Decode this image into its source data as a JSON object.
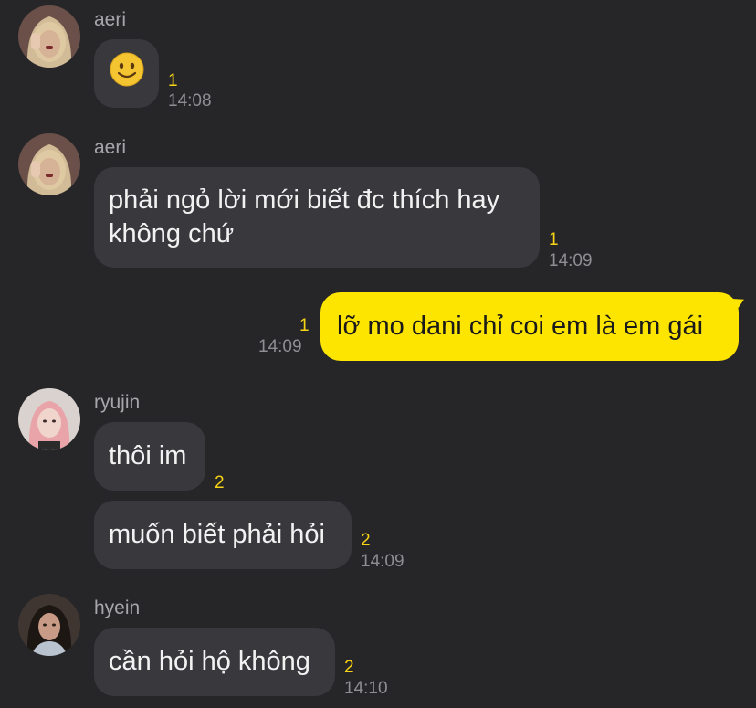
{
  "messages": [
    {
      "sender": "aeri",
      "avatar": "avatar-aeri",
      "text": "🙂",
      "unread": "1",
      "time": "14:08"
    },
    {
      "sender": "aeri",
      "avatar": "avatar-aeri",
      "text": "phải ngỏ lời mới biết đc thích hay không chứ",
      "unread": "1",
      "time": "14:09"
    },
    {
      "sender": "me",
      "text": "lỡ mo dani chỉ coi em là em gái",
      "unread": "1",
      "time": "14:09"
    },
    {
      "sender": "ryujin",
      "avatar": "avatar-ryujin",
      "text": "thôi im",
      "unread": "2",
      "time": ""
    },
    {
      "sender": "ryujin",
      "avatar": "avatar-ryujin",
      "text": "muốn biết phải hỏi",
      "unread": "2",
      "time": "14:09"
    },
    {
      "sender": "hyein",
      "avatar": "avatar-hyein",
      "text": "cần hỏi hộ không",
      "unread": "2",
      "time": "14:10"
    }
  ],
  "colors": {
    "background": "#262629",
    "incoming_bubble": "#39393d",
    "outgoing_bubble": "#fee500",
    "unread_count": "#f7d315",
    "timestamp": "#8e8e93"
  }
}
